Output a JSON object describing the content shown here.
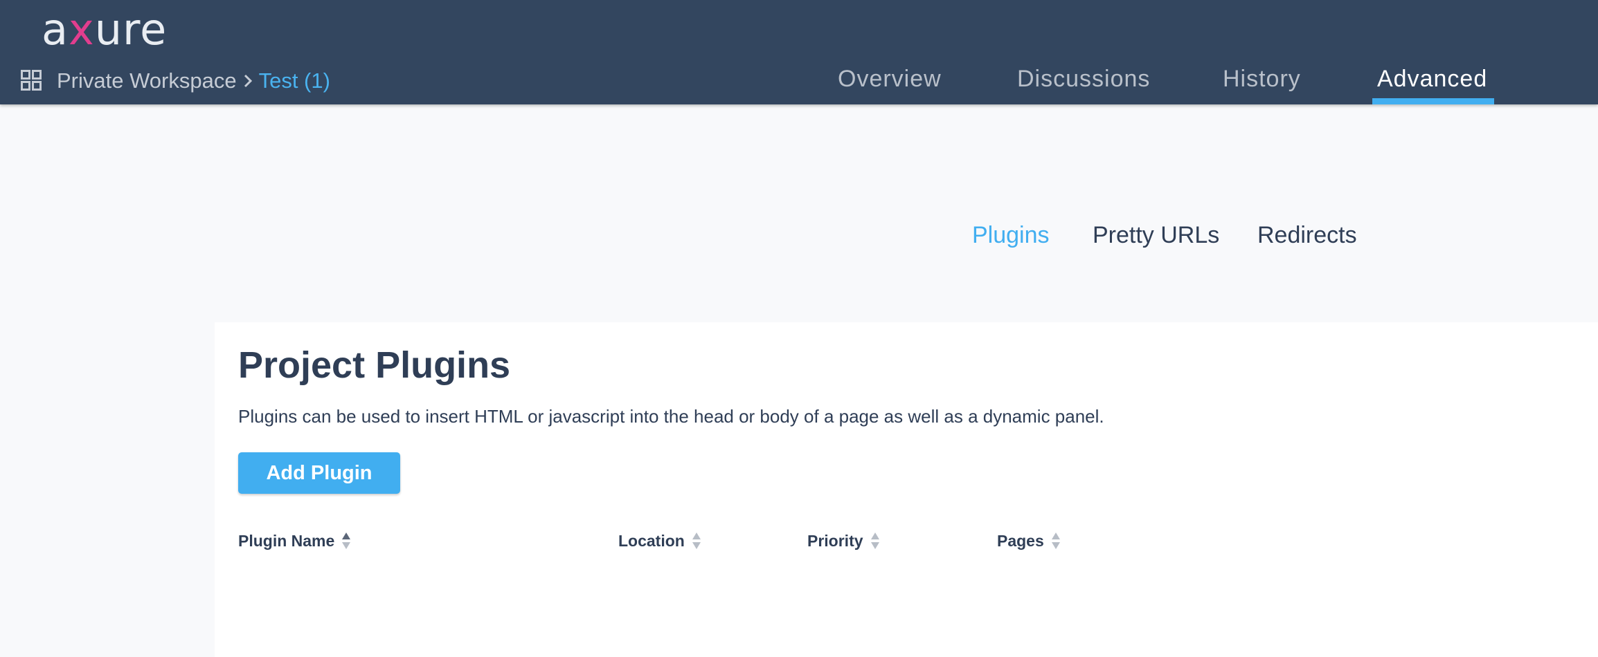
{
  "header": {
    "logo_text_a": "a",
    "logo_text_x": "x",
    "logo_text_ure": "ure",
    "breadcrumb": {
      "workspace": "Private Workspace",
      "project": "Test (1)"
    },
    "nav_tabs": [
      {
        "label": "Overview"
      },
      {
        "label": "Discussions"
      },
      {
        "label": "History"
      },
      {
        "label": "Advanced",
        "active": true
      }
    ]
  },
  "subtabs": [
    {
      "label": "Plugins",
      "active": true
    },
    {
      "label": "Pretty URLs"
    },
    {
      "label": "Redirects"
    }
  ],
  "panel": {
    "title": "Project Plugins",
    "description": "Plugins can be used to insert HTML or javascript into the head or body of a page as well as a dynamic panel.",
    "add_button_label": "Add Plugin",
    "table": {
      "columns": [
        "Plugin Name",
        "Location",
        "Priority",
        "Pages"
      ],
      "rows": []
    }
  },
  "colors": {
    "header_bg": "#33465f",
    "accent": "#41aef0",
    "logo_x": "#e23d8e",
    "text_dark": "#2f3e56"
  }
}
